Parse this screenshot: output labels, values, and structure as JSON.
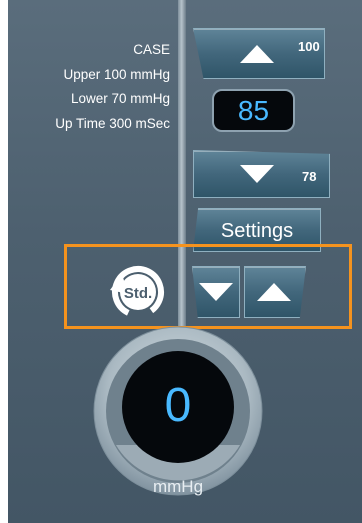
{
  "info": {
    "mode": "CASE",
    "upper": "Upper 100 mmHg",
    "lower": "Lower 70 mmHg",
    "uptime": "Up Time 300 mSec"
  },
  "controls": {
    "upper_limit": "100",
    "lower_limit": "78",
    "current_value": "85",
    "settings_label": "Settings"
  },
  "std": {
    "label": "Std."
  },
  "gauge": {
    "value": "0",
    "unit": "mmHg"
  },
  "colors": {
    "accent_blue": "#49b9ff",
    "highlight_orange": "#f5931e",
    "button_blue": "#42677c"
  }
}
